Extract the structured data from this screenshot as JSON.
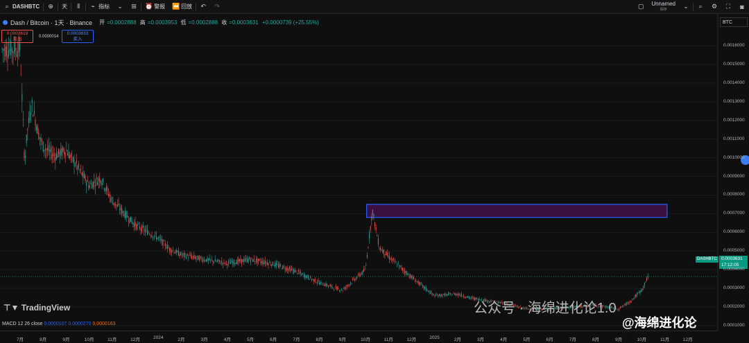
{
  "toolbar": {
    "symbol": "DASHBTC",
    "interval": "天",
    "indicators": "指标",
    "alert": "警报",
    "replay": "回放",
    "layout_name": "Unnamed",
    "layout_sub": "保存"
  },
  "legend": {
    "title": "Dash / Bitcoin · 1天 · Binance",
    "open_label": "开",
    "open": "=0.0002888",
    "high_label": "高",
    "high": "=0.0003953",
    "low_label": "低",
    "low": "=0.0002888",
    "close_label": "收",
    "close": "=0.0003631",
    "change": "+0.0000739 (+25.55%)"
  },
  "trade": {
    "sell_price": "0.0003619",
    "sell_label": "卖出",
    "spread": "0.0000014",
    "buy_price": "0.0003633",
    "buy_label": "买入"
  },
  "timeframe": "BTC",
  "macd": {
    "label": "MACD 12 26 close",
    "v1": "0.0000107",
    "v2": "0.0000270",
    "v3": "0.0000163"
  },
  "current": {
    "symbol": "DASHBTC",
    "price": "0.0003631",
    "countdown": "17:12:05"
  },
  "brand": "TradingView",
  "watermark1": "公众号 · 海绵进化论1.0",
  "watermark2": "@海绵进化论",
  "colors": {
    "up": "#26a69a",
    "down": "#ef5350",
    "zone_fill": "#3a1040",
    "zone_border": "#2962ff"
  },
  "chart_data": {
    "type": "line",
    "title": "Dash / Bitcoin · 1天 · Binance",
    "xlabel": "",
    "ylabel": "",
    "y_ticks": [
      "0.0016000",
      "0.0015000",
      "0.0014000",
      "0.0013000",
      "0.0012000",
      "0.0011000",
      "0.0010000",
      "0.0009000",
      "0.0008000",
      "0.0007000",
      "0.0006000",
      "0.0005000",
      "0.0004000",
      "0.0003000",
      "0.0002000",
      "0.0001000"
    ],
    "x_ticks": [
      "7月",
      "8月",
      "9月",
      "10月",
      "11月",
      "12月",
      "2024",
      "2月",
      "3月",
      "4月",
      "5月",
      "6月",
      "7月",
      "8月",
      "9月",
      "10月",
      "11月",
      "12月",
      "2025",
      "2月",
      "3月",
      "4月",
      "5月",
      "6月",
      "7月",
      "8月",
      "9月",
      "10月",
      "11月",
      "12月"
    ],
    "ylim": [
      2e-05,
      0.00172
    ],
    "series": [
      {
        "x": [
          0.0,
          0.2,
          0.3,
          0.5,
          0.8,
          1.0,
          1.5,
          2.0,
          2.5,
          3.0,
          3.5,
          4.0,
          5.0,
          6.0,
          6.5,
          7.0,
          8.0,
          9.0,
          10.0,
          11.0,
          12.0,
          13.0,
          14.0,
          15.0,
          15.3,
          15.6,
          16.0,
          17.0,
          18.0,
          19.0,
          19.5,
          20.0,
          21.0,
          22.0,
          23.0,
          24.0,
          25.0,
          26.0,
          26.5,
          27.0,
          27.3
        ],
        "values": [
          0.00158,
          0.00097,
          0.00113,
          0.00129,
          0.00113,
          0.00106,
          0.00101,
          0.00104,
          0.00095,
          0.00085,
          0.00089,
          0.00077,
          0.00064,
          0.00057,
          0.00051,
          0.00048,
          0.000455,
          0.000435,
          0.000455,
          0.00043,
          0.00039,
          0.00033,
          0.00029,
          0.0004,
          0.00072,
          0.00052,
          0.00047,
          0.00036,
          0.00026,
          0.00027,
          0.00025,
          0.00024,
          0.00022,
          0.00019,
          0.00019,
          0.0002,
          0.00021,
          0.00019,
          0.00023,
          0.00029,
          0.00037
        ]
      }
    ],
    "zone": {
      "x": [
        15.05,
        28.1
      ],
      "y": [
        0.00068,
        0.00075
      ]
    },
    "current_price": 0.0003631
  }
}
